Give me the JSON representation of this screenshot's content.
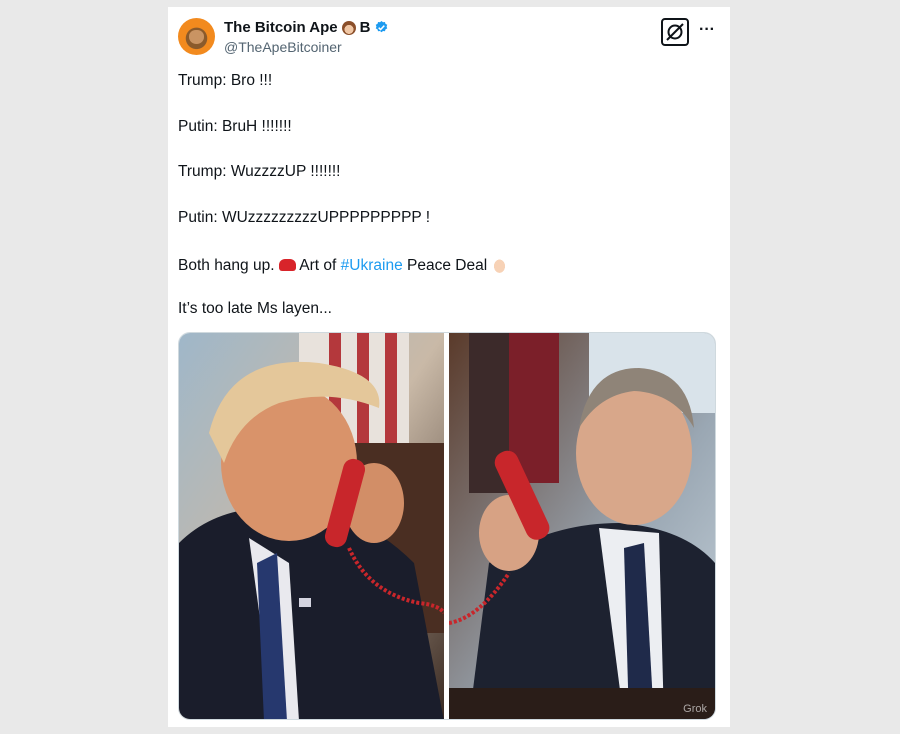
{
  "post": {
    "author": {
      "display_name": "The Bitcoin Ape",
      "name_badge_text": "B",
      "handle": "@TheApeBitcoiner",
      "verified": true,
      "avatar_icon": "ape-avatar"
    },
    "actions": {
      "grok_icon": "grok-icon",
      "more_label": "···"
    },
    "lines": [
      "Trump: Bro !!!",
      "Putin: BruH !!!!!!!",
      "Trump: WuzzzzUP !!!!!!!",
      "Putin: WUzzzzzzzzzUPPPPPPPPP !"
    ],
    "deal_line": {
      "before": "Both hang up.",
      "middle": "Art of",
      "hashtag": "#Ukraine",
      "after": "Peace Deal"
    },
    "closing_line": "It’s too late Ms layen...",
    "media": {
      "left_image": "photo-trump-on-red-phone",
      "right_image": "photo-putin-on-red-phone",
      "watermark": "Grok"
    },
    "colors": {
      "link": "#1d9bf0",
      "verified": "#1d9bf0",
      "handle": "#536471",
      "phone": "#d8242a"
    }
  }
}
